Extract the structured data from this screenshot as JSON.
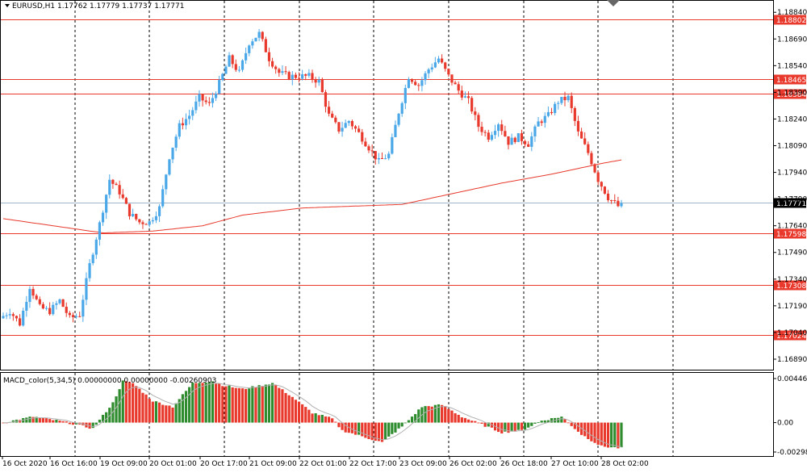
{
  "header": {
    "symbol_line": "EURUSD,H1  1.17762 1.17779 1.17737 1.17771"
  },
  "macd": {
    "label": "MACD_color(5,34,5) 0.00000000 0.00000000 -0.00260903"
  },
  "price_axis": {
    "ticks": [
      "1.18840",
      "1.18690",
      "1.18540",
      "1.18390",
      "1.18240",
      "1.18090",
      "1.17940",
      "1.17790",
      "1.17640",
      "1.17490",
      "1.17340",
      "1.17190",
      "1.17040",
      "1.16890"
    ],
    "tick_values": [
      1.1884,
      1.1869,
      1.1854,
      1.1839,
      1.1824,
      1.1809,
      1.1794,
      1.1779,
      1.1764,
      1.1749,
      1.1734,
      1.1719,
      1.1704,
      1.1689
    ]
  },
  "macd_axis": {
    "ticks": [
      "0.004464",
      "0.00",
      "-0.00298"
    ],
    "tick_values": [
      0.004464,
      0.0,
      -0.00298
    ]
  },
  "levels": [
    {
      "value": 1.18802,
      "label": "1.18802"
    },
    {
      "value": 1.18465,
      "label": "1.18465"
    },
    {
      "value": 1.18384,
      "label": "1.18384"
    },
    {
      "value": 1.17598,
      "label": "1.17598"
    },
    {
      "value": 1.17308,
      "label": "1.17308"
    },
    {
      "value": 1.17024,
      "label": "1.17024"
    }
  ],
  "current_price": {
    "value": 1.17771,
    "label": "1.17771"
  },
  "time_axis": {
    "labels": [
      "16 Oct 2020",
      "16 Oct 16:00",
      "19 Oct 09:00",
      "20 Oct 01:00",
      "20 Oct 17:00",
      "21 Oct 09:00",
      "22 Oct 01:00",
      "22 Oct 17:00",
      "23 Oct 09:00",
      "26 Oct 02:00",
      "26 Oct 18:00",
      "27 Oct 10:00",
      "28 Oct 02:00"
    ]
  },
  "colors": {
    "bull": "#4aa8e8",
    "bear": "#e8392c",
    "level": "#e8392c",
    "ma": "#e8392c",
    "macd_up": "#2e8b2e",
    "macd_down": "#e8392c",
    "signal": "#b0b0b0",
    "current_line": "#9eb4c8"
  },
  "chart_data": {
    "type": "candlestick",
    "symbol": "EURUSD",
    "timeframe": "H1",
    "y_range": [
      1.1684,
      1.189
    ],
    "ohlc_path": [
      [
        0,
        1.1712
      ],
      [
        3,
        1.1716
      ],
      [
        6,
        1.1709
      ],
      [
        9,
        1.173
      ],
      [
        12,
        1.1718
      ],
      [
        15,
        1.1716
      ],
      [
        18,
        1.1722
      ],
      [
        21,
        1.1712
      ],
      [
        24,
        1.1714
      ],
      [
        27,
        1.1742
      ],
      [
        30,
        1.1765
      ],
      [
        33,
        1.179
      ],
      [
        36,
        1.1783
      ],
      [
        39,
        1.1771
      ],
      [
        42,
        1.1766
      ],
      [
        45,
        1.1766
      ],
      [
        48,
        1.1774
      ],
      [
        51,
        1.1803
      ],
      [
        54,
        1.182
      ],
      [
        57,
        1.1826
      ],
      [
        60,
        1.1836
      ],
      [
        63,
        1.1832
      ],
      [
        66,
        1.1844
      ],
      [
        69,
        1.1858
      ],
      [
        72,
        1.185
      ],
      [
        75,
        1.1867
      ],
      [
        78,
        1.1872
      ],
      [
        81,
        1.1858
      ],
      [
        84,
        1.185
      ],
      [
        87,
        1.1848
      ],
      [
        90,
        1.1848
      ],
      [
        93,
        1.1848
      ],
      [
        96,
        1.1845
      ],
      [
        99,
        1.1826
      ],
      [
        102,
        1.1818
      ],
      [
        105,
        1.1823
      ],
      [
        108,
        1.1816
      ],
      [
        111,
        1.1808
      ],
      [
        114,
        1.18
      ],
      [
        117,
        1.1804
      ],
      [
        120,
        1.1828
      ],
      [
        123,
        1.1848
      ],
      [
        126,
        1.1843
      ],
      [
        129,
        1.1852
      ],
      [
        132,
        1.1858
      ],
      [
        135,
        1.1848
      ],
      [
        138,
        1.184
      ],
      [
        141,
        1.1834
      ],
      [
        144,
        1.182
      ],
      [
        147,
        1.1814
      ],
      [
        150,
        1.1822
      ],
      [
        153,
        1.1811
      ],
      [
        156,
        1.1814
      ],
      [
        159,
        1.181
      ],
      [
        162,
        1.1822
      ],
      [
        165,
        1.1826
      ],
      [
        168,
        1.1834
      ],
      [
        171,
        1.1836
      ],
      [
        174,
        1.1816
      ],
      [
        177,
        1.1805
      ],
      [
        180,
        1.179
      ],
      [
        183,
        1.178
      ],
      [
        186,
        1.1775
      ]
    ],
    "moving_average": [
      [
        0,
        1.1768
      ],
      [
        30,
        1.176
      ],
      [
        45,
        1.1761
      ],
      [
        60,
        1.1764
      ],
      [
        72,
        1.177
      ],
      [
        90,
        1.1774
      ],
      [
        120,
        1.1776
      ],
      [
        135,
        1.1782
      ],
      [
        150,
        1.1788
      ],
      [
        165,
        1.1793
      ],
      [
        180,
        1.1799
      ],
      [
        186,
        1.1801
      ]
    ],
    "macd_path": [
      [
        0,
        0.0
      ],
      [
        9,
        0.0006
      ],
      [
        18,
        0.0001
      ],
      [
        27,
        -0.0006
      ],
      [
        33,
        0.002
      ],
      [
        36,
        0.0042
      ],
      [
        39,
        0.004
      ],
      [
        45,
        0.0022
      ],
      [
        51,
        0.0016
      ],
      [
        57,
        0.004
      ],
      [
        63,
        0.0042
      ],
      [
        66,
        0.0038
      ],
      [
        72,
        0.0034
      ],
      [
        81,
        0.004
      ],
      [
        87,
        0.0026
      ],
      [
        93,
        0.001
      ],
      [
        99,
        0.0004
      ],
      [
        102,
        -0.0008
      ],
      [
        108,
        -0.0014
      ],
      [
        114,
        -0.002
      ],
      [
        120,
        -0.0004
      ],
      [
        126,
        0.0016
      ],
      [
        132,
        0.0018
      ],
      [
        138,
        0.0006
      ],
      [
        144,
        -0.0002
      ],
      [
        150,
        -0.001
      ],
      [
        156,
        -0.0008
      ],
      [
        162,
        0.0002
      ],
      [
        168,
        0.0006
      ],
      [
        174,
        -0.0012
      ],
      [
        180,
        -0.0024
      ],
      [
        186,
        -0.0026
      ]
    ],
    "macd_range": [
      -0.00298,
      0.004464
    ],
    "total_bars": 187
  }
}
